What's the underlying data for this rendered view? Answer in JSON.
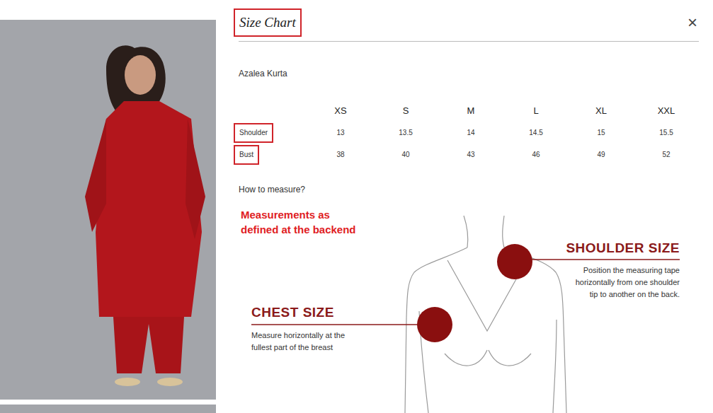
{
  "header": {
    "title": "Size Chart",
    "title_highlighted": true,
    "close": "×"
  },
  "product": "Azalea Kurta",
  "table": {
    "columns": [
      "XS",
      "S",
      "M",
      "L",
      "XL",
      "XXL"
    ],
    "rows": [
      {
        "label": "Shoulder",
        "highlighted": true,
        "values": [
          "13",
          "13.5",
          "14",
          "14.5",
          "15",
          "15.5"
        ]
      },
      {
        "label": "Bust",
        "highlighted": true,
        "values": [
          "38",
          "40",
          "43",
          "46",
          "49",
          "52"
        ]
      }
    ]
  },
  "how_to_measure": "How to measure?",
  "annotation": [
    "Measurements as",
    "defined at the backend"
  ],
  "guides": [
    {
      "title": "SHOULDER SIZE",
      "lines": [
        "Position the measuring tape",
        "horizontally from one shoulder",
        "tip to another on the back."
      ]
    },
    {
      "title": "CHEST SIZE",
      "lines": [
        "Measure horizontally at the",
        "fullest part of the breast"
      ]
    }
  ]
}
